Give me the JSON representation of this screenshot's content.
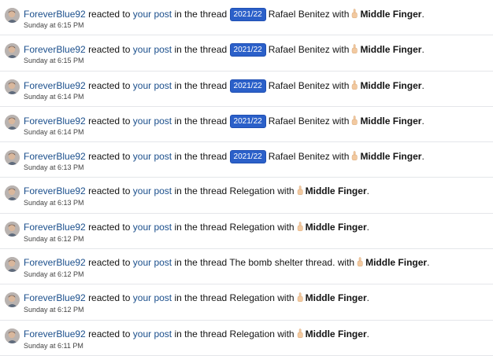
{
  "common": {
    "reacted_to": "reacted to",
    "your_post": "your post",
    "in_the_thread": "in the thread",
    "with": "with",
    "period": "."
  },
  "items": [
    {
      "user": "ForeverBlue92",
      "prefix": "2021/22",
      "thread": "Rafael Benitez",
      "reaction": "Middle Finger",
      "time": "Sunday at 6:15 PM"
    },
    {
      "user": "ForeverBlue92",
      "prefix": "2021/22",
      "thread": "Rafael Benitez",
      "reaction": "Middle Finger",
      "time": "Sunday at 6:15 PM"
    },
    {
      "user": "ForeverBlue92",
      "prefix": "2021/22",
      "thread": "Rafael Benitez",
      "reaction": "Middle Finger",
      "time": "Sunday at 6:14 PM"
    },
    {
      "user": "ForeverBlue92",
      "prefix": "2021/22",
      "thread": "Rafael Benitez",
      "reaction": "Middle Finger",
      "time": "Sunday at 6:14 PM"
    },
    {
      "user": "ForeverBlue92",
      "prefix": "2021/22",
      "thread": "Rafael Benitez",
      "reaction": "Middle Finger",
      "time": "Sunday at 6:13 PM"
    },
    {
      "user": "ForeverBlue92",
      "prefix": "",
      "thread": "Relegation",
      "reaction": "Middle Finger",
      "time": "Sunday at 6:13 PM"
    },
    {
      "user": "ForeverBlue92",
      "prefix": "",
      "thread": "Relegation",
      "reaction": "Middle Finger",
      "time": "Sunday at 6:12 PM"
    },
    {
      "user": "ForeverBlue92",
      "prefix": "",
      "thread": "The bomb shelter thread.",
      "reaction": "Middle Finger",
      "time": "Sunday at 6:12 PM"
    },
    {
      "user": "ForeverBlue92",
      "prefix": "",
      "thread": "Relegation",
      "reaction": "Middle Finger",
      "time": "Sunday at 6:12 PM"
    },
    {
      "user": "ForeverBlue92",
      "prefix": "",
      "thread": "Relegation",
      "reaction": "Middle Finger",
      "time": "Sunday at 6:11 PM"
    }
  ],
  "colors": {
    "link": "#1b4f8c",
    "badge": "#2b60c9"
  },
  "icons": {
    "avatar": "user-avatar",
    "reaction": "middle-finger-emoji-icon"
  }
}
